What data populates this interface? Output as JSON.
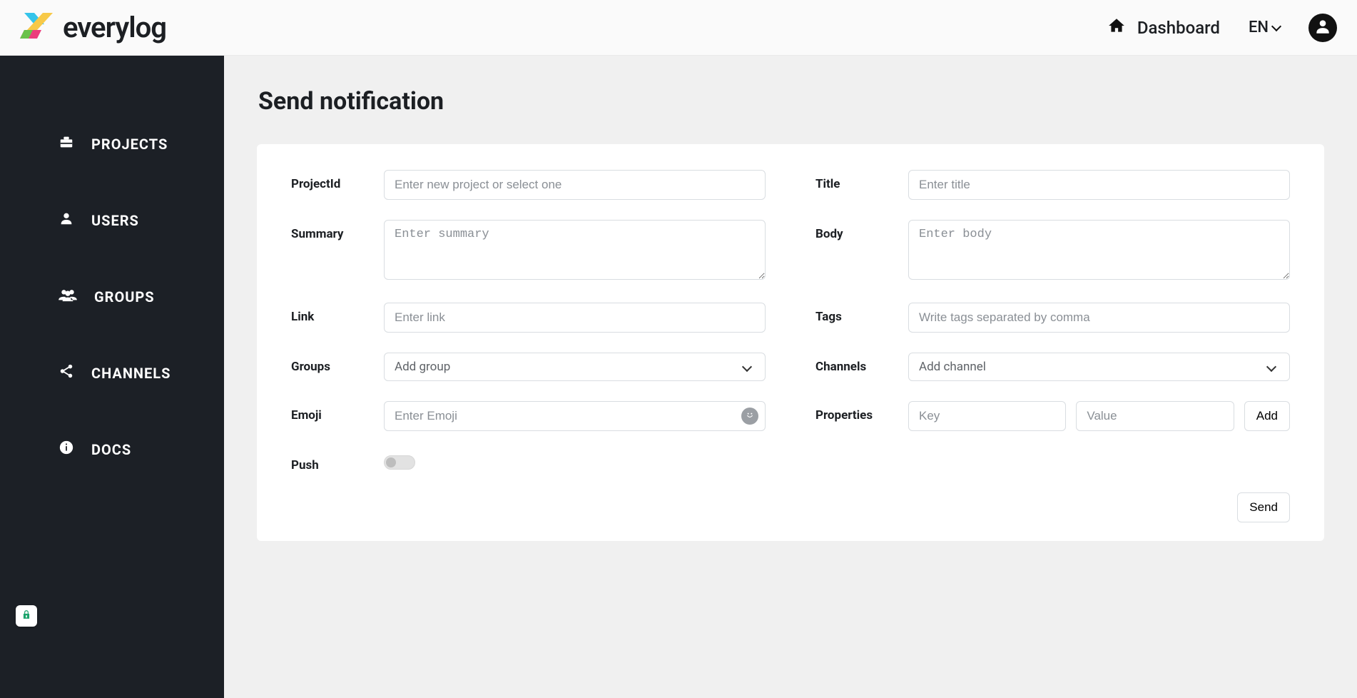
{
  "brand": {
    "name": "everylog"
  },
  "header": {
    "dashboard_label": "Dashboard",
    "lang_label": "EN"
  },
  "sidebar": {
    "items": [
      {
        "label": "PROJECTS",
        "icon": "briefcase-icon"
      },
      {
        "label": "USERS",
        "icon": "user-icon"
      },
      {
        "label": "GROUPS",
        "icon": "group-icon"
      },
      {
        "label": "CHANNELS",
        "icon": "share-icon"
      },
      {
        "label": "DOCS",
        "icon": "info-icon"
      }
    ]
  },
  "page": {
    "title": "Send notification"
  },
  "form": {
    "projectId": {
      "label": "ProjectId",
      "placeholder": "Enter new project or select one"
    },
    "title": {
      "label": "Title",
      "placeholder": "Enter title"
    },
    "summary": {
      "label": "Summary",
      "placeholder": "Enter summary"
    },
    "body": {
      "label": "Body",
      "placeholder": "Enter body"
    },
    "link": {
      "label": "Link",
      "placeholder": "Enter link"
    },
    "tags": {
      "label": "Tags",
      "placeholder": "Write tags separated by comma"
    },
    "groups": {
      "label": "Groups",
      "selected": "Add group"
    },
    "channels": {
      "label": "Channels",
      "selected": "Add channel"
    },
    "emoji": {
      "label": "Emoji",
      "placeholder": "Enter Emoji"
    },
    "properties": {
      "label": "Properties",
      "key_placeholder": "Key",
      "value_placeholder": "Value",
      "add_label": "Add"
    },
    "push": {
      "label": "Push",
      "value": false
    },
    "send_label": "Send"
  }
}
